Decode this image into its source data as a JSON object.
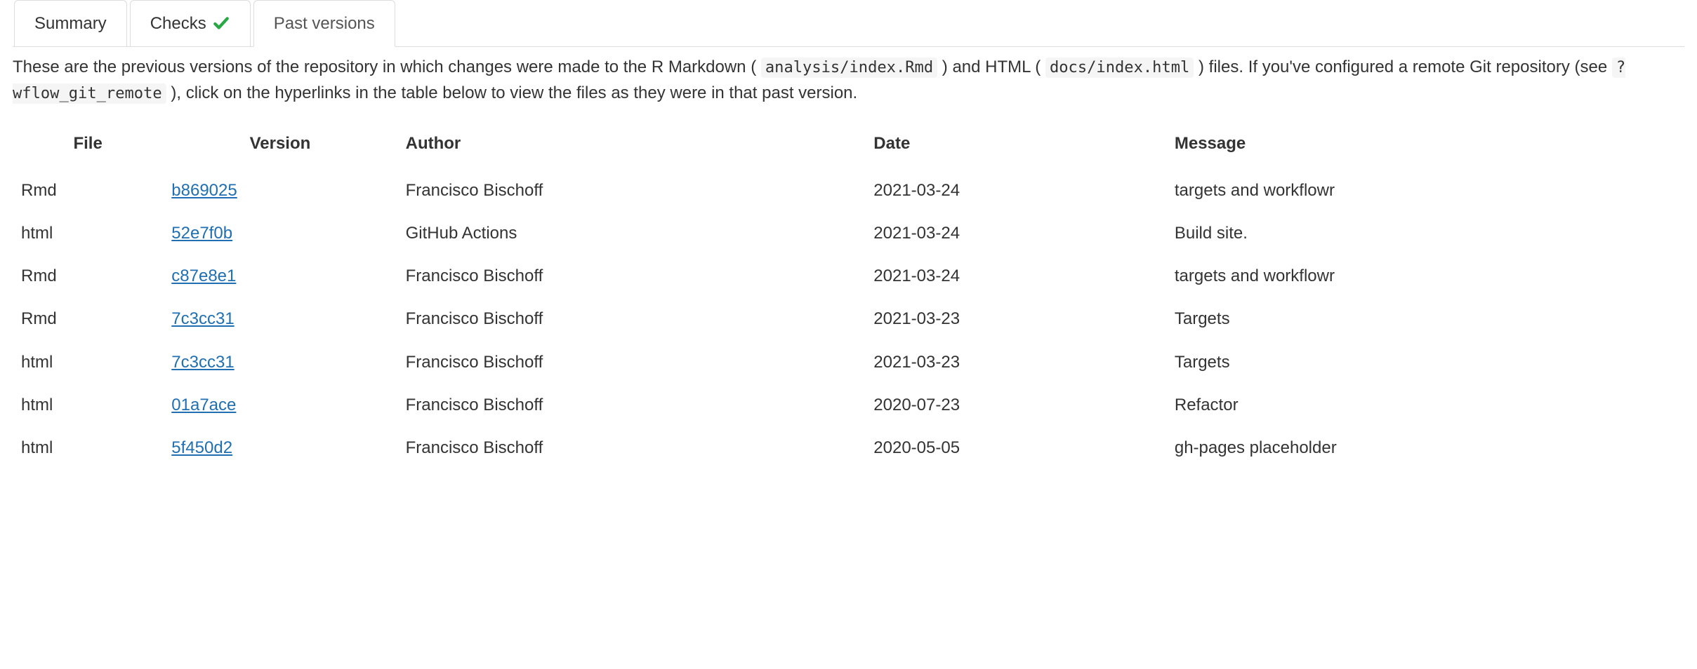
{
  "tabs": {
    "summary": "Summary",
    "checks": "Checks",
    "past": "Past versions"
  },
  "desc": {
    "p1a": "These are the previous versions of the repository in which changes were made to the R Markdown (",
    "code1": "analysis/index.Rmd",
    "p1b": ") and HTML (",
    "code2": "docs/index.html",
    "p1c": ") files. If you've configured a remote Git repository (see ",
    "code3": "?wflow_git_remote",
    "p1d": "), click on the hyperlinks in the table below to view the files as they were in that past version."
  },
  "table": {
    "headers": {
      "file": "File",
      "version": "Version",
      "author": "Author",
      "date": "Date",
      "message": "Message"
    },
    "rows": [
      {
        "file": "Rmd",
        "version": "b869025",
        "author": "Francisco Bischoff",
        "date": "2021-03-24",
        "message": "targets and workflowr"
      },
      {
        "file": "html",
        "version": "52e7f0b",
        "author": "GitHub Actions",
        "date": "2021-03-24",
        "message": "Build site."
      },
      {
        "file": "Rmd",
        "version": "c87e8e1",
        "author": "Francisco Bischoff",
        "date": "2021-03-24",
        "message": "targets and workflowr"
      },
      {
        "file": "Rmd",
        "version": "7c3cc31",
        "author": "Francisco Bischoff",
        "date": "2021-03-23",
        "message": "Targets"
      },
      {
        "file": "html",
        "version": "7c3cc31",
        "author": "Francisco Bischoff",
        "date": "2021-03-23",
        "message": "Targets"
      },
      {
        "file": "html",
        "version": "01a7ace",
        "author": "Francisco Bischoff",
        "date": "2020-07-23",
        "message": "Refactor"
      },
      {
        "file": "html",
        "version": "5f450d2",
        "author": "Francisco Bischoff",
        "date": "2020-05-05",
        "message": "gh-pages placeholder"
      }
    ]
  }
}
